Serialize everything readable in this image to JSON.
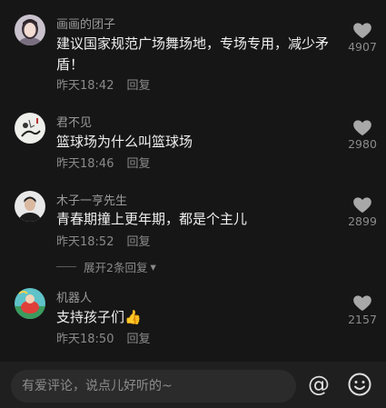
{
  "comments": [
    {
      "username": "画画的团子",
      "text": "建议国家规范广场舞场地，专场专用，减少矛盾！",
      "time": "昨天18:42",
      "reply_label": "回复",
      "likes": "4907",
      "avatar": "girl-avatar"
    },
    {
      "username": "君不见",
      "text": "篮球场为什么叫篮球场",
      "time": "昨天18:46",
      "reply_label": "回复",
      "likes": "2980",
      "avatar": "ink-painting-avatar"
    },
    {
      "username": "木子一亨先生",
      "text": "青春期撞上更年期，都是个主儿",
      "time": "昨天18:52",
      "reply_label": "回复",
      "likes": "2899",
      "avatar": "man-avatar"
    },
    {
      "username": "机器人",
      "text": "支持孩子们",
      "emoji": "👍",
      "time": "昨天18:50",
      "reply_label": "回复",
      "likes": "2157",
      "avatar": "colorful-avatar"
    }
  ],
  "expand_replies": {
    "label": "展开2条回复",
    "arrow": "▾"
  },
  "input_bar": {
    "placeholder": "有爱评论，说点儿好听的~",
    "at_symbol": "@"
  },
  "colors": {
    "background": "#161616",
    "username": "#9a9a9a",
    "meta": "#8a8a8a",
    "text": "#f0f0f0",
    "heart": "#a8a8a8"
  }
}
